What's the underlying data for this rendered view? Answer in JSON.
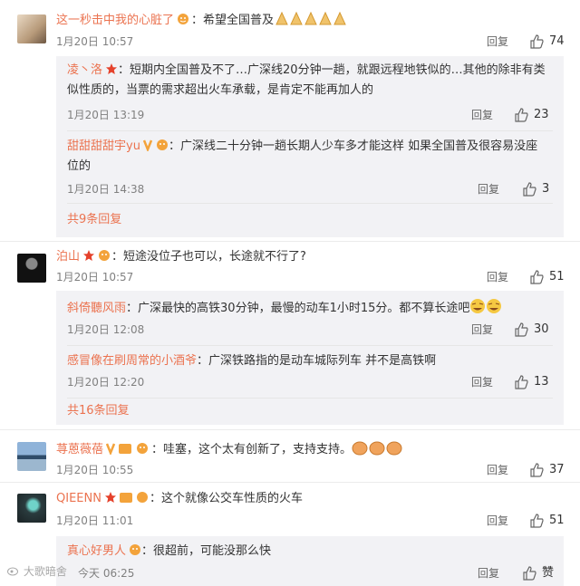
{
  "actions": {
    "reply_label": "回复"
  },
  "comments": [
    {
      "user": "这一秒击中我的心脏了",
      "text": "希望全国普及",
      "time": "1月20日 10:57",
      "likes": "74",
      "replies": [
        {
          "user": "凌丶洛",
          "text": "短期内全国普及不了…广深线20分钟一趟，就跟远程地铁似的…其他的除非有类",
          "text2": "似性质的，当票的需求超出火车承载，是肯定不能再加人的",
          "time": "1月20日 13:19",
          "likes": "23"
        },
        {
          "user": "甜甜甜甜宇yu",
          "text": "广深线二十分钟一趟长期人少车多才能这样 如果全国普及很容易没座",
          "text2": "位的",
          "time": "1月20日 14:38",
          "likes": "3"
        }
      ],
      "more": "共9条回复"
    },
    {
      "user": "泊山",
      "text": "短途没位子也可以，长途就不行了?",
      "time": "1月20日 10:57",
      "likes": "51",
      "replies": [
        {
          "user": "斜倚聽风雨",
          "text": "广深最快的高铁30分钟，最慢的动车1小时15分。都不算长途吧",
          "time": "1月20日 12:08",
          "likes": "30"
        },
        {
          "user": "感冒像在刷周常的小酒爷",
          "text": "广深铁路指的是动车城际列车 并不是高铁啊",
          "time": "1月20日 12:20",
          "likes": "13"
        }
      ],
      "more": "共16条回复"
    },
    {
      "user": "荨蒽薇蓓",
      "text": "哇塞，这个太有创新了，支持支持。",
      "time": "1月20日 10:55",
      "likes": "37"
    },
    {
      "user": "QIEENN",
      "text": "这个就像公交车性质的火车",
      "time": "1月20日 11:01",
      "likes": "51",
      "replies": [
        {
          "user": "真心好男人",
          "text": "很超前，可能没那么快",
          "time": "今天 06:25",
          "likes": "赞"
        }
      ]
    }
  ],
  "watermark": "大歌暗舍"
}
